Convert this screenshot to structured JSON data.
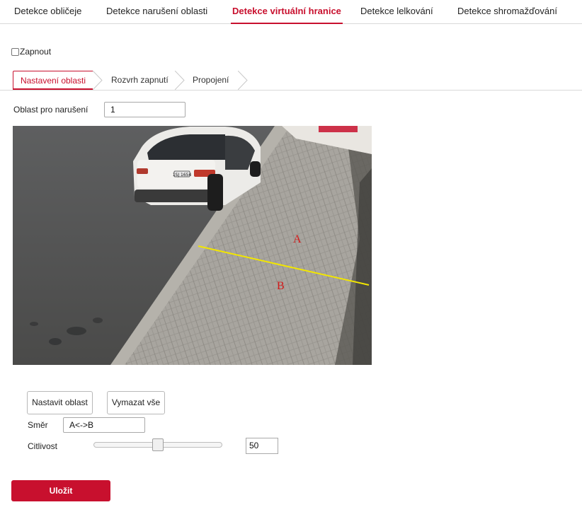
{
  "top_tabs": {
    "face": "Detekce obličeje",
    "intrusion": "Detekce narušení oblasti",
    "line_crossing": "Detekce virtuální hranice",
    "loitering": "Detekce lelkování",
    "crowd": "Detekce shromažďování"
  },
  "enable": {
    "label": "Zapnout",
    "checked": false
  },
  "sub_tabs": {
    "area": "Nastavení oblasti",
    "schedule": "Rozvrh zapnutí",
    "linkage": "Propojení"
  },
  "area_select": {
    "label": "Oblast pro narušení",
    "value": "1"
  },
  "video": {
    "side_a_label": "A",
    "side_b_label": "B",
    "plate_text": "1SJ 1654",
    "line_color": "#f2e600"
  },
  "buttons": {
    "set_area": "Nastavit oblast",
    "clear_all": "Vymazat vše",
    "save": "Uložit"
  },
  "direction": {
    "label": "Směr",
    "value": "A<->B"
  },
  "sensitivity": {
    "label": "Citlivost",
    "value": "50",
    "level_percent": 50
  },
  "colors": {
    "accent": "#c8102e"
  }
}
